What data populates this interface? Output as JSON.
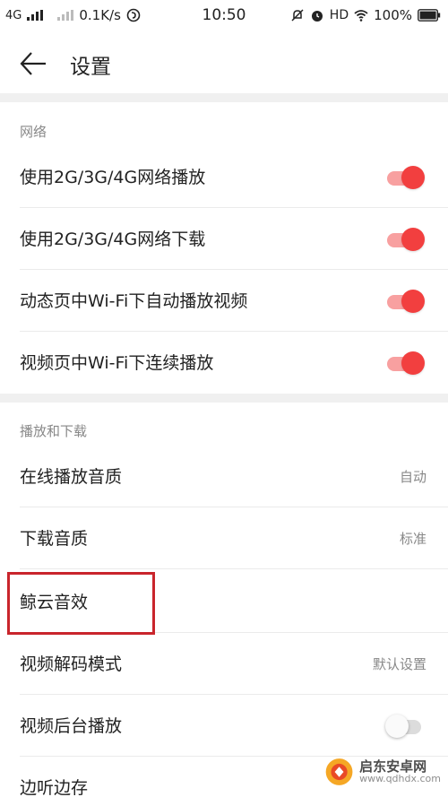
{
  "status_bar": {
    "network1": "4G",
    "speed": "0.1K/s",
    "time": "10:50",
    "hd": "HD",
    "battery": "100%"
  },
  "header": {
    "title": "设置"
  },
  "sections": [
    {
      "label": "网络",
      "rows": [
        {
          "label": "使用2G/3G/4G网络播放",
          "toggle": "on"
        },
        {
          "label": "使用2G/3G/4G网络下载",
          "toggle": "on"
        },
        {
          "label": "动态页中Wi-Fi下自动播放视频",
          "toggle": "on"
        },
        {
          "label": "视频页中Wi-Fi下连续播放",
          "toggle": "on"
        }
      ]
    },
    {
      "label": "播放和下载",
      "rows": [
        {
          "label": "在线播放音质",
          "value": "自动"
        },
        {
          "label": "下载音质",
          "value": "标准"
        },
        {
          "label": "鲸云音效",
          "value": ""
        },
        {
          "label": "视频解码模式",
          "value": "默认设置"
        },
        {
          "label": "视频后台播放",
          "toggle": "off"
        },
        {
          "label": "边听边存",
          "value": ""
        }
      ]
    }
  ],
  "watermark": {
    "title": "启东安卓网",
    "url": "www.qdhdx.com"
  },
  "colors": {
    "toggle_on": "#f23f3f",
    "highlight": "#c9252c"
  }
}
